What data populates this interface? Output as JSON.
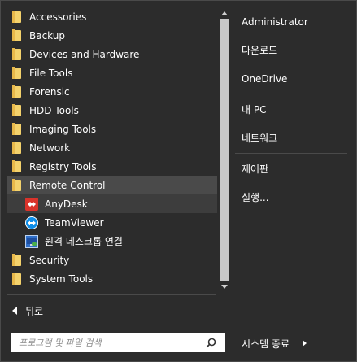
{
  "programs": {
    "items": [
      {
        "label": "Accessories",
        "type": "folder"
      },
      {
        "label": "Backup",
        "type": "folder"
      },
      {
        "label": "Devices and Hardware",
        "type": "folder"
      },
      {
        "label": "File Tools",
        "type": "folder"
      },
      {
        "label": "Forensic",
        "type": "folder"
      },
      {
        "label": "HDD Tools",
        "type": "folder"
      },
      {
        "label": "Imaging Tools",
        "type": "folder"
      },
      {
        "label": "Network",
        "type": "folder"
      },
      {
        "label": "Registry Tools",
        "type": "folder"
      },
      {
        "label": "Remote Control",
        "type": "folder-open"
      },
      {
        "label": "AnyDesk",
        "type": "app"
      },
      {
        "label": "TeamViewer",
        "type": "app"
      },
      {
        "label": "원격 데스크톱 연결",
        "type": "app"
      },
      {
        "label": "Security",
        "type": "folder"
      },
      {
        "label": "System Tools",
        "type": "folder"
      }
    ],
    "icons": {
      "folder": "folder-icon",
      "anydesk": "anydesk-icon",
      "teamviewer": "teamviewer-icon",
      "rdp": "remote-desktop-icon"
    }
  },
  "back": {
    "label": "뒤로"
  },
  "search": {
    "placeholder": "프로그램 및 파일 검색",
    "value": ""
  },
  "right_panel": {
    "items": [
      {
        "label": "Administrator"
      },
      {
        "label": "다운로드"
      },
      {
        "label": "OneDrive"
      },
      {
        "label": "내 PC"
      },
      {
        "label": "네트워크"
      },
      {
        "label": "제어판"
      },
      {
        "label": "실행..."
      }
    ]
  },
  "shutdown": {
    "label": "시스템 종료"
  },
  "colors": {
    "background": "#2c2c2c",
    "selected": "#4a4a4a",
    "folder": "#f4d26c",
    "anydesk": "#d9332b",
    "teamviewer": "#0e8ee9"
  }
}
